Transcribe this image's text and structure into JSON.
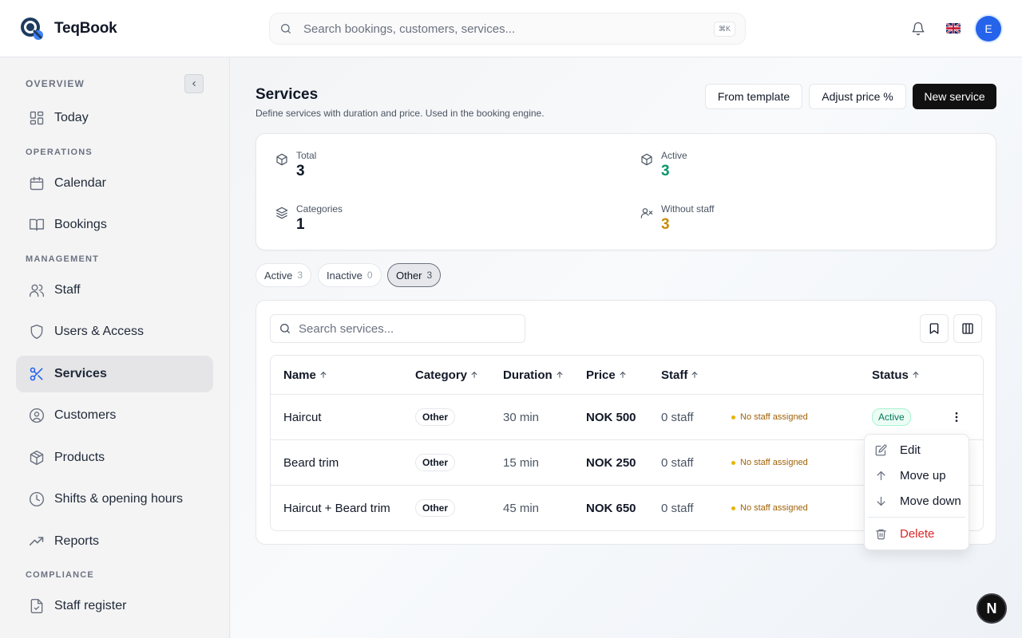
{
  "app": {
    "name": "TeqBook"
  },
  "header": {
    "search_placeholder": "Search bookings, customers, services...",
    "search_shortcut": "⌘K",
    "avatar_initial": "E"
  },
  "sidebar": {
    "sections": [
      "OVERVIEW",
      "OPERATIONS",
      "MANAGEMENT",
      "COMPLIANCE"
    ],
    "items": [
      {
        "label": "Today",
        "icon": "dashboard-icon"
      },
      {
        "label": "Calendar",
        "icon": "calendar-icon"
      },
      {
        "label": "Bookings",
        "icon": "book-icon"
      },
      {
        "label": "Staff",
        "icon": "users-icon"
      },
      {
        "label": "Users & Access",
        "icon": "shield-icon"
      },
      {
        "label": "Services",
        "icon": "scissors-icon",
        "active": true
      },
      {
        "label": "Customers",
        "icon": "user-circle-icon"
      },
      {
        "label": "Products",
        "icon": "package-icon"
      },
      {
        "label": "Shifts & opening hours",
        "icon": "clock-icon"
      },
      {
        "label": "Reports",
        "icon": "trending-up-icon"
      },
      {
        "label": "Staff register",
        "icon": "file-check-icon"
      }
    ]
  },
  "page": {
    "title": "Services",
    "subtitle": "Define services with duration and price. Used in the booking engine.",
    "buttons": {
      "template": "From template",
      "adjust": "Adjust price %",
      "new": "New service"
    }
  },
  "stats": {
    "total": {
      "label": "Total",
      "value": "3"
    },
    "active": {
      "label": "Active",
      "value": "3",
      "color": "#059669"
    },
    "categories": {
      "label": "Categories",
      "value": "1"
    },
    "without_staff": {
      "label": "Without staff",
      "value": "3",
      "color": "#ca8a04"
    }
  },
  "filters": [
    {
      "label": "Active",
      "count": "3"
    },
    {
      "label": "Inactive",
      "count": "0"
    },
    {
      "label": "Other",
      "count": "3",
      "selected": true
    }
  ],
  "table": {
    "search_placeholder": "Search services...",
    "columns": {
      "name": "Name",
      "category": "Category",
      "duration": "Duration",
      "price": "Price",
      "staff": "Staff",
      "status": "Status"
    },
    "rows": [
      {
        "name": "Haircut",
        "category": "Other",
        "duration": "30 min",
        "price": "NOK 500",
        "staff": "0 staff",
        "warning": "No staff assigned",
        "status": "Active"
      },
      {
        "name": "Beard trim",
        "category": "Other",
        "duration": "15 min",
        "price": "NOK 250",
        "staff": "0 staff",
        "warning": "No staff assigned",
        "status": ""
      },
      {
        "name": "Haircut + Beard trim",
        "category": "Other",
        "duration": "45 min",
        "price": "NOK 650",
        "staff": "0 staff",
        "warning": "No staff assigned",
        "status": ""
      }
    ]
  },
  "row_menu": {
    "edit": "Edit",
    "move_up": "Move up",
    "move_down": "Move down",
    "delete": "Delete"
  },
  "dev_badge": "N"
}
